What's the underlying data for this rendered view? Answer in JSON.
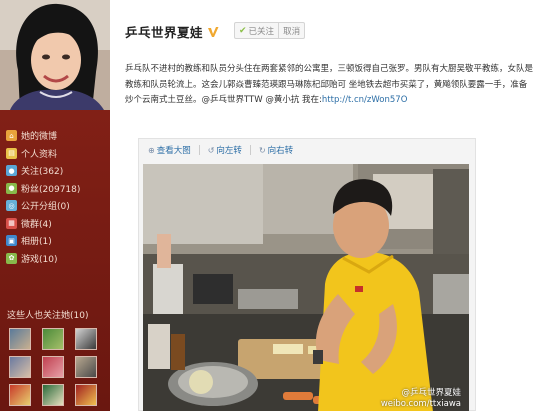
{
  "sidebar": {
    "nav": [
      {
        "label": "她的微博",
        "icon": "home-icon",
        "color": "#e9a33b"
      },
      {
        "label": "个人资料",
        "icon": "profile-icon",
        "color": "#e9c24a"
      },
      {
        "label": "关注(362)",
        "icon": "follow-icon",
        "color": "#5aa6d6"
      },
      {
        "label": "粉丝(209718)",
        "icon": "fans-icon",
        "color": "#88b94b"
      },
      {
        "label": "公开分组(0)",
        "icon": "group-icon",
        "color": "#67b0d8"
      },
      {
        "label": "微群(4)",
        "icon": "weiqun-icon",
        "color": "#d9514a"
      },
      {
        "label": "相册(1)",
        "icon": "album-icon",
        "color": "#3f88cc"
      },
      {
        "label": "游戏(10)",
        "icon": "game-icon",
        "color": "#88b94b"
      }
    ],
    "follow_title": "这些人也关注她(10)"
  },
  "header": {
    "user_name": "乒乓世界夏娃",
    "followed_label": "已关注",
    "cancel_label": "取消"
  },
  "post": {
    "text": "乒乓队不进村的教练和队员分头住在两套紧邻的公寓里，三顿饭得自己张罗。男队有大厨吴敬平教练，女队是教练和队员轮流上。这会儿郭焱曹臻范瑛跟马琳陈杞邱贻可 坐地铁去超市买菜了，黄飚领队要露一手，准备炒个云南式土豆丝。@乒乓世界TTW @黄小抗 我在:",
    "link": "http://t.cn/zWon57O"
  },
  "media": {
    "tools": [
      {
        "label": "查看大图",
        "icon": "zoom-icon",
        "glyph": "⊕"
      },
      {
        "label": "向左转",
        "icon": "rotate-left-icon",
        "glyph": "↺"
      },
      {
        "label": "向右转",
        "icon": "rotate-right-icon",
        "glyph": "↻"
      }
    ],
    "watermark_name": "@乒乓世界夏娃",
    "watermark_url": "weibo.com/ttxiawa"
  },
  "colors": {
    "sidebar_bg": "#7a1c14",
    "link": "#2c6ea6",
    "verified": "#f0a830"
  }
}
